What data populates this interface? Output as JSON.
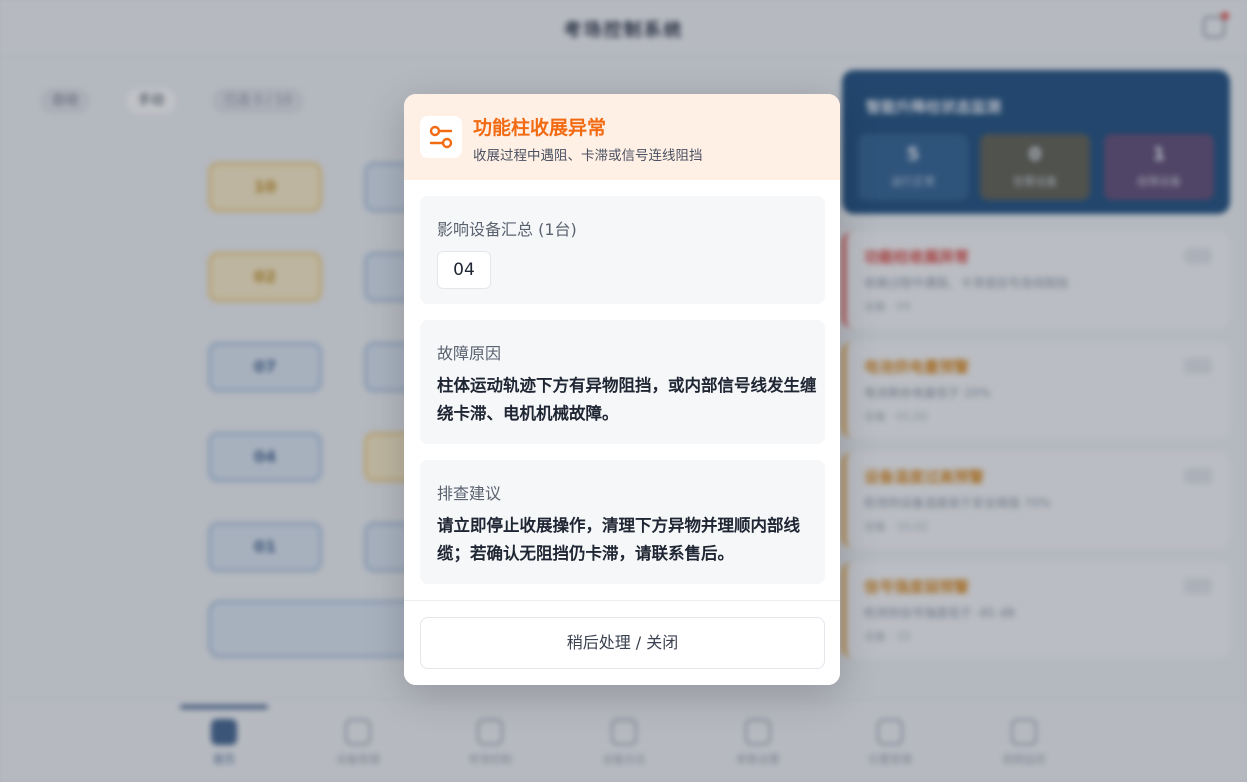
{
  "background": {
    "app_title": "考场控制系统",
    "modes": [
      "自动",
      "手动",
      "已选 0 / 10"
    ],
    "devices": [
      "10",
      "02",
      "07",
      "04",
      "01"
    ],
    "panel": {
      "title": "智能升降柱状态监测",
      "stats": [
        {
          "num": "5",
          "label": "运行正常"
        },
        {
          "num": "0",
          "label": "告警设备"
        },
        {
          "num": "1",
          "label": "故障设备"
        }
      ]
    },
    "alerts": [
      {
        "title": "功能柱收展异常",
        "desc": "收展过程中遇阻、卡滞或信号连线阻挡",
        "meta": "设备 · 04"
      },
      {
        "title": "电池供电量预警",
        "desc": "电池剩余电量低于 20%",
        "meta": "设备 · 01,02"
      },
      {
        "title": "设备温度过高预警",
        "desc": "检测到设备温度高于安全阈值 70%",
        "meta": "设备 · 10,02"
      },
      {
        "title": "信号强度弱预警",
        "desc": "检测到信号强度低于 -85 dB",
        "meta": "设备 · 10"
      }
    ],
    "nav": [
      "首页",
      "设备管理",
      "考场控制",
      "设备日志",
      "参数设置",
      "位置管理",
      "视频监控"
    ]
  },
  "modal": {
    "title": "功能柱收展异常",
    "subtitle": "收展过程中遇阻、卡滞或信号连线阻挡",
    "affected_label": "影响设备汇总 (1台)",
    "affected_devices": [
      "04"
    ],
    "cause_label": "故障原因",
    "cause_text": "柱体运动轨迹下方有异物阻挡，或内部信号线发生缠绕卡滞、电机机械故障。",
    "advice_label": "排查建议",
    "advice_text": "请立即停止收展操作，清理下方异物并理顺内部线缆；若确认无阻挡仍卡滞，请联系售后。",
    "close_label": "稍后处理 / 关闭"
  },
  "colors": {
    "accent": "#f26a12",
    "header_bg": "#fff0e6",
    "card_bg": "#f6f7f9"
  },
  "icons": {
    "modal_icon": "toggle-slider-icon"
  }
}
